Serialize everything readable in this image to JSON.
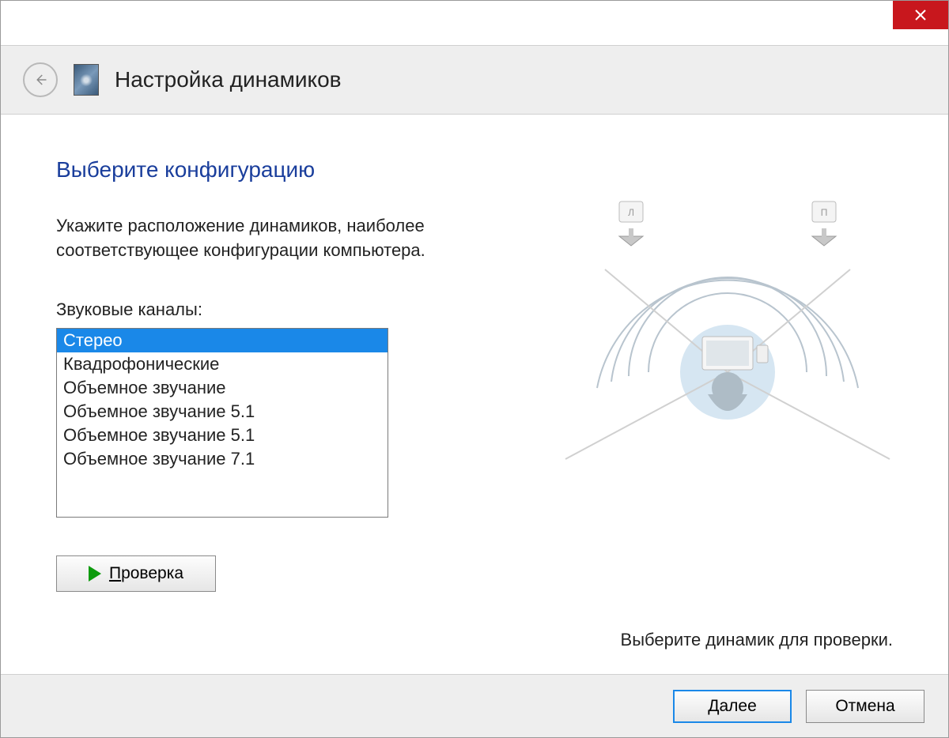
{
  "header": {
    "title": "Настройка динамиков"
  },
  "page": {
    "title": "Выберите конфигурацию",
    "instruction": "Укажите расположение динамиков, наиболее соответствующее конфигурации компьютера.",
    "channels_label": "Звуковые каналы:",
    "test_button_label": "Проверка",
    "hint": "Выберите динамик для проверки."
  },
  "channels": {
    "items": [
      "Стерео",
      "Квадрофонические",
      "Объемное звучание",
      "Объемное звучание 5.1",
      "Объемное звучание 5.1",
      "Объемное звучание 7.1"
    ],
    "selected_index": 0
  },
  "diagram": {
    "left_speaker_label": "Л",
    "right_speaker_label": "П"
  },
  "footer": {
    "next_label": "Далее",
    "cancel_label": "Отмена"
  }
}
